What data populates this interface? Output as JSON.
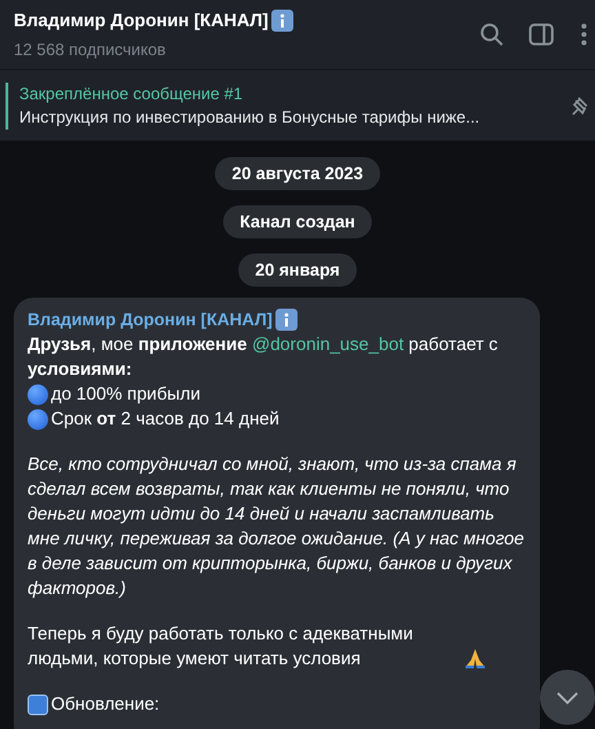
{
  "header": {
    "title": "Владимир Доронин [КАНАЛ]",
    "subtitle": "12 568 подписчиков"
  },
  "pinned": {
    "title": "Закреплённое сообщение #1",
    "text": "Инструкция по инвестированию в Бонусные тарифы ниже..."
  },
  "service": [
    {
      "text": "20 августа 2023"
    },
    {
      "text": "Канал создан"
    },
    {
      "text": "20 января"
    }
  ],
  "message": {
    "author": "Владимир Доронин [КАНАЛ]",
    "blocks": [
      {
        "kind": "link",
        "before": "**Друзья**, мое **приложение** ",
        "link": "@doronin_use_bot",
        "after": " работает с **условиями:**"
      },
      {
        "kind": "bullet",
        "text": "до 100% прибыли"
      },
      {
        "kind": "bullet",
        "text": "Срок **от** 2 часов до 14 дней"
      },
      {
        "kind": "gap"
      },
      {
        "kind": "italic",
        "text": "Все, кто сотрудничал со мной, знают, что из-за спама я сделал всем возвраты, так как клиенты не поняли, что деньги могут идти до 14 дней и начали заспамливать мне личку, переживая за долгое ожидание. (А у нас многое в деле зависит от крипторынка, биржи, банков и других факторов.)"
      },
      {
        "kind": "gap"
      },
      {
        "kind": "pray",
        "text": "Теперь я буду работать только с адекватными людьми, которые умеют читать условия"
      },
      {
        "kind": "gap"
      },
      {
        "kind": "new",
        "text": "Обновление:"
      }
    ]
  }
}
